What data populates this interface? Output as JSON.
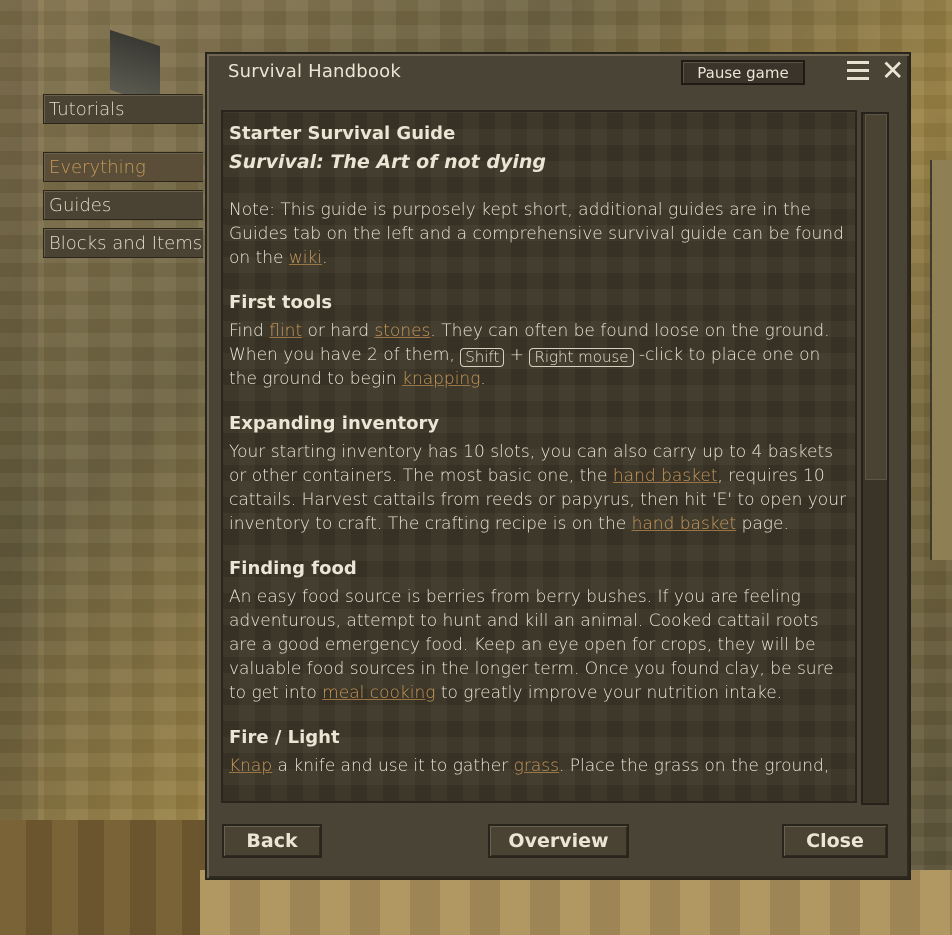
{
  "sidebar": {
    "tabs": [
      {
        "label": "Tutorials",
        "active": false
      },
      {
        "label": "Everything",
        "active": true
      },
      {
        "label": "Guides",
        "active": false
      },
      {
        "label": "Blocks and Items",
        "active": false
      }
    ]
  },
  "dialog": {
    "title": "Survival Handbook",
    "pause_label": "Pause game",
    "menu_icon": "hamburger-menu-icon",
    "close_icon": "close-icon"
  },
  "guide": {
    "title": "Starter Survival Guide",
    "subtitle": "Survival: The Art of not dying",
    "note": {
      "t1": "Note: This guide is purposely kept short, additional guides are in the Guides tab on the left and a comprehensive survival guide can be found on the ",
      "link": "wiki",
      "t2": "."
    },
    "sections": [
      {
        "heading": "First tools",
        "t1": "Find ",
        "l1": "flint",
        "t2": " or hard ",
        "l2": "stones",
        "t3": ". They can often be found loose on the ground. When you have 2 of them, ",
        "key1": "Shift",
        "t4": " + ",
        "key2": "Right mouse",
        "t5": " -click to place one on the ground to begin ",
        "l3": "knapping",
        "t6": "."
      },
      {
        "heading": "Expanding inventory",
        "t1": "Your starting inventory has 10 slots, you can also carry up to 4 baskets or other containers. The most basic one, the ",
        "l1": "hand basket",
        "t2": ", requires 10 cattails. Harvest cattails from reeds or papyrus, then hit 'E' to open your inventory to craft. The crafting recipe is on the ",
        "l2": "hand basket",
        "t3": " page."
      },
      {
        "heading": "Finding food",
        "t1": "An easy food source is berries from berry bushes. If you are feeling adventurous, attempt to hunt and kill an animal. Cooked cattail roots are a good emergency food. Keep an eye open for crops, they will be valuable food sources in the longer term. Once you found clay, be sure to get into ",
        "l1": "meal cooking",
        "t2": " to greatly improve your nutrition intake."
      },
      {
        "heading": "Fire / Light",
        "l1": "Knap",
        "t1": " a knife and use it to gather ",
        "l2": "grass",
        "t2": ". Place the grass on the ground,"
      }
    ]
  },
  "footer": {
    "back_label": "Back",
    "overview_label": "Overview",
    "close_label": "Close"
  },
  "colors": {
    "link": "#c99a5a",
    "text": "#ece5d6",
    "panel": "#4a4436"
  }
}
